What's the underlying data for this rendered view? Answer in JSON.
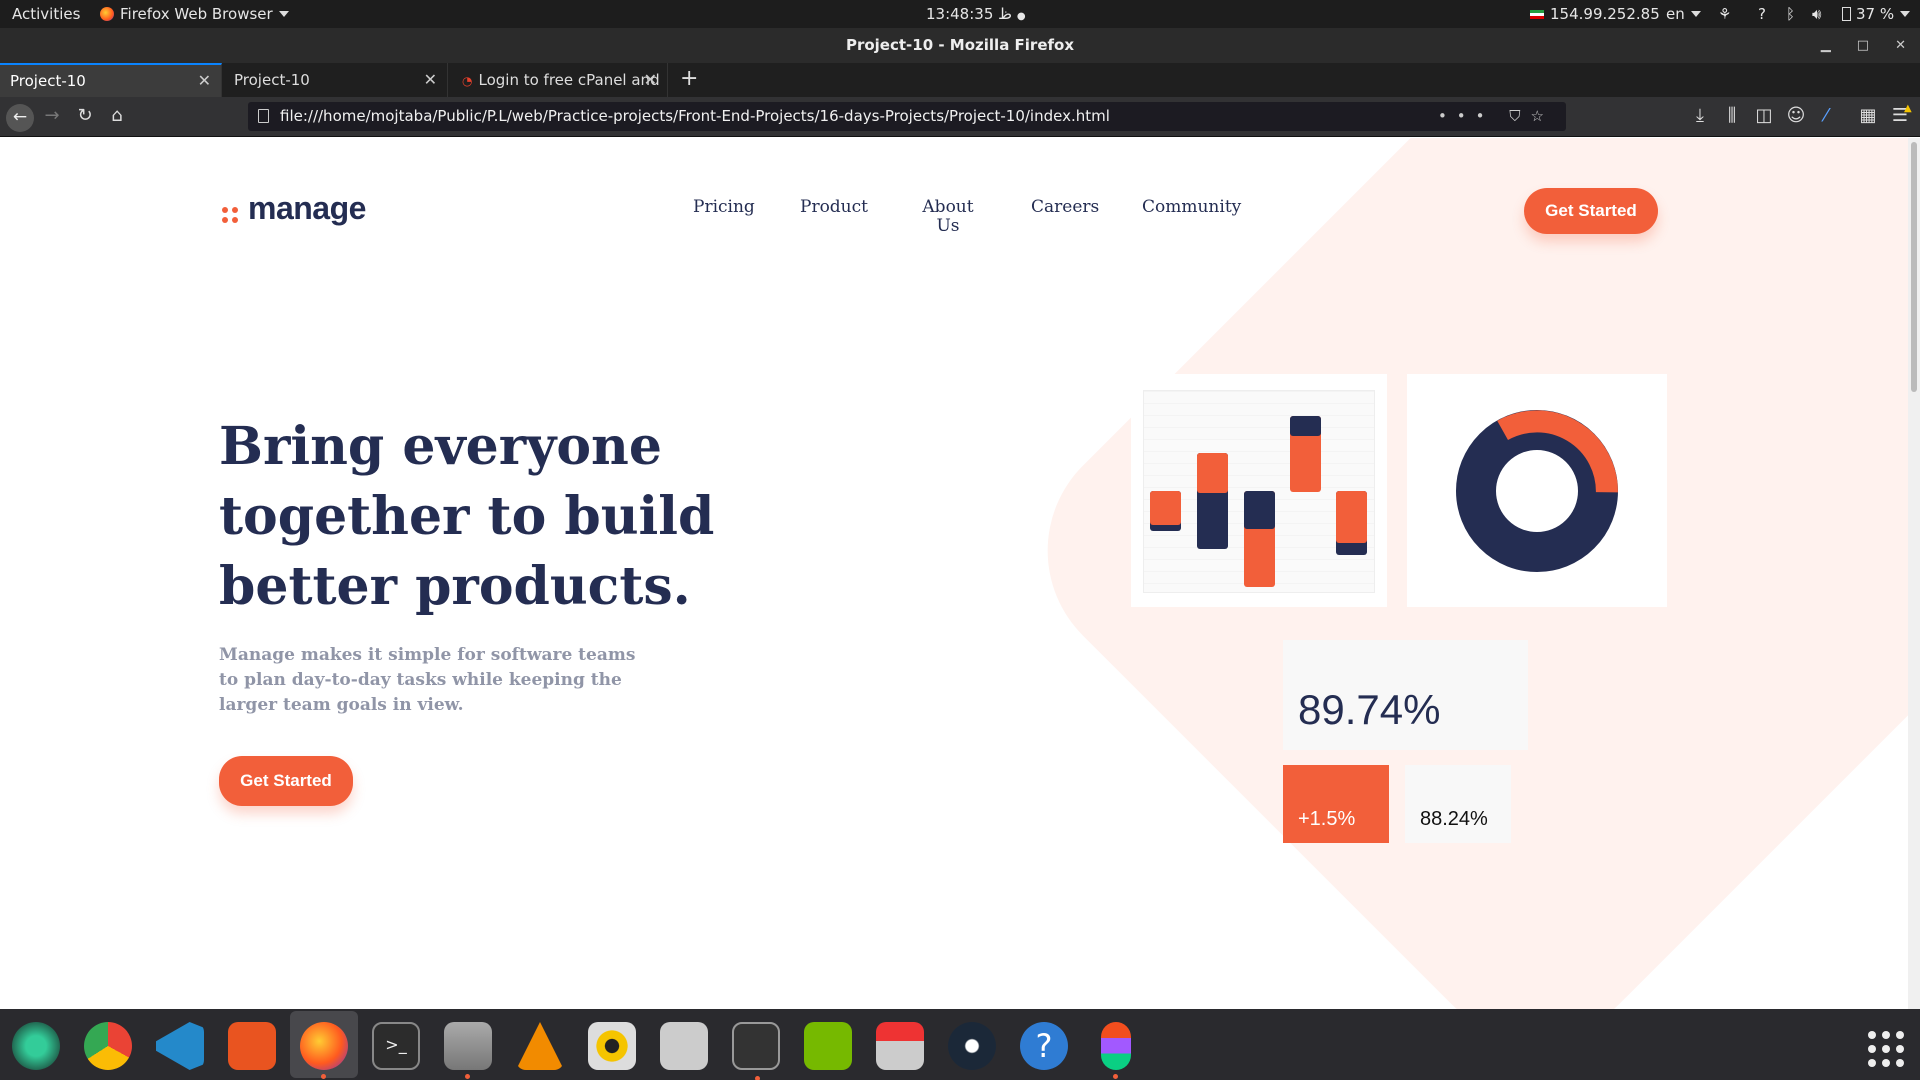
{
  "system_bar": {
    "activities": "Activities",
    "app_name": "Firefox Web Browser",
    "clock": "13:48:35",
    "clock_suffix": "ظ",
    "ip": "154.99.252.85",
    "lang": "en",
    "battery": "37 %"
  },
  "window": {
    "title": "Project-10 - Mozilla Firefox"
  },
  "tabs": [
    {
      "label": "Project-10",
      "active": true
    },
    {
      "label": "Project-10",
      "active": false
    },
    {
      "label": "Login to free cPanel and",
      "active": false
    }
  ],
  "toolbar": {
    "url": "file:///home/mojtaba/Public/P.L/web/Practice-projects/Front-End-Projects/16-days-Projects/Project-10/index.html",
    "url_actions": "•••"
  },
  "page": {
    "logo": "manage",
    "nav": [
      "Pricing",
      "Product",
      "About Us",
      "Careers",
      "Community"
    ],
    "header_cta": "Get Started",
    "hero_title": "Bring everyone together to build better products.",
    "hero_description": "Manage makes it simple for software teams to plan day-to-day tasks while keeping the larger team goals in view.",
    "hero_cta": "Get Started",
    "stats": {
      "main": "89.74%",
      "change": "+1.5%",
      "secondary": "88.24%"
    },
    "colors": {
      "accent": "#f25f3a",
      "navy": "#242d52",
      "muted": "#9095a7",
      "tint": "#fff2ee"
    }
  },
  "dock": {
    "apps": [
      "atom-icon",
      "chrome-icon",
      "vscode-icon",
      "software-center-icon",
      "firefox-icon",
      "terminal-icon",
      "files-icon",
      "vlc-icon",
      "rhythmbox-icon",
      "mixer-icon",
      "system-monitor-icon",
      "nvidia-icon",
      "installer-icon",
      "steam-icon",
      "help-icon",
      "figma-icon"
    ],
    "show_apps": "show-applications-icon"
  }
}
